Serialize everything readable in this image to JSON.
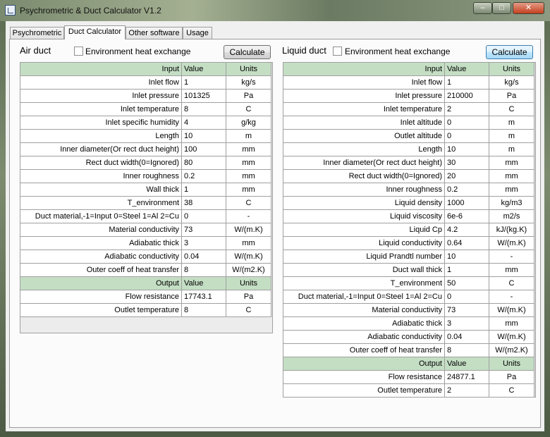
{
  "window": {
    "title": "Psychrometric & Duct Calculator V1.2",
    "minimize": "–",
    "maximize": "□",
    "close": "✕"
  },
  "tabs": [
    {
      "label": "Psychrometric"
    },
    {
      "label": "Duct Calculator"
    },
    {
      "label": "Other software"
    },
    {
      "label": "Usage"
    }
  ],
  "air": {
    "title": "Air duct",
    "env_label": "Environment heat exchange",
    "env_checked": false,
    "calc_label": "Calculate",
    "input_header": [
      "Input",
      "Value",
      "Units"
    ],
    "inputs": [
      [
        "Inlet flow",
        "1",
        "kg/s"
      ],
      [
        "Inlet pressure",
        "101325",
        "Pa"
      ],
      [
        "Inlet temperature",
        "8",
        "C"
      ],
      [
        "Inlet specific humidity",
        "4",
        "g/kg"
      ],
      [
        "Length",
        "10",
        "m"
      ],
      [
        "Inner diameter(Or rect duct height)",
        "100",
        "mm"
      ],
      [
        "Rect duct width(0=Ignored)",
        "80",
        "mm"
      ],
      [
        "Inner roughness",
        "0.2",
        "mm"
      ],
      [
        "Wall thick",
        "1",
        "mm"
      ],
      [
        "T_environment",
        "38",
        "C"
      ],
      [
        "Duct material,-1=Input 0=Steel 1=Al 2=Cu",
        "0",
        "-"
      ],
      [
        "Material conductivity",
        "73",
        "W/(m.K)"
      ],
      [
        "Adiabatic thick",
        "3",
        "mm"
      ],
      [
        "Adiabatic conductivity",
        "0.04",
        "W/(m.K)"
      ],
      [
        "Outer coeff of heat transfer",
        "8",
        "W/(m2.K)"
      ]
    ],
    "output_header": [
      "Output",
      "Value",
      "Units"
    ],
    "outputs": [
      [
        "Flow resistance",
        "17743.1",
        "Pa"
      ],
      [
        "Outlet temperature",
        "8",
        "C"
      ]
    ]
  },
  "liquid": {
    "title": "Liquid duct",
    "env_label": "Environment heat exchange",
    "env_checked": false,
    "calc_label": "Calculate",
    "input_header": [
      "Input",
      "Value",
      "Units"
    ],
    "inputs": [
      [
        "Inlet flow",
        "1",
        "kg/s"
      ],
      [
        "Inlet pressure",
        "210000",
        "Pa"
      ],
      [
        "Inlet temperature",
        "2",
        "C"
      ],
      [
        "Inlet altitude",
        "0",
        "m"
      ],
      [
        "Outlet altitude",
        "0",
        "m"
      ],
      [
        "Length",
        "10",
        "m"
      ],
      [
        "Inner diameter(Or rect duct height)",
        "30",
        "mm"
      ],
      [
        "Rect duct width(0=Ignored)",
        "20",
        "mm"
      ],
      [
        "Inner roughness",
        "0.2",
        "mm"
      ],
      [
        "Liquid density",
        "1000",
        "kg/m3"
      ],
      [
        "Liquid viscosity",
        "6e-6",
        "m2/s"
      ],
      [
        "Liquid Cp",
        "4.2",
        "kJ/(kg.K)"
      ],
      [
        "Liquid conductivity",
        "0.64",
        "W/(m.K)"
      ],
      [
        "Liquid Prandtl number",
        "10",
        "-"
      ],
      [
        "Duct wall thick",
        "1",
        "mm"
      ],
      [
        "T_environment",
        "50",
        "C"
      ],
      [
        "Duct material,-1=Input 0=Steel 1=Al 2=Cu",
        "0",
        "-"
      ],
      [
        "Material conductivity",
        "73",
        "W/(m.K)"
      ],
      [
        "Adiabatic thick",
        "3",
        "mm"
      ],
      [
        "Adiabatic conductivity",
        "0.04",
        "W/(m.K)"
      ],
      [
        "Outer coeff of heat transfer",
        "8",
        "W/(m2.K)"
      ]
    ],
    "output_header": [
      "Output",
      "Value",
      "Units"
    ],
    "outputs": [
      [
        "Flow resistance",
        "24877.1",
        "Pa"
      ],
      [
        "Outlet temperature",
        "2",
        "C"
      ]
    ]
  }
}
